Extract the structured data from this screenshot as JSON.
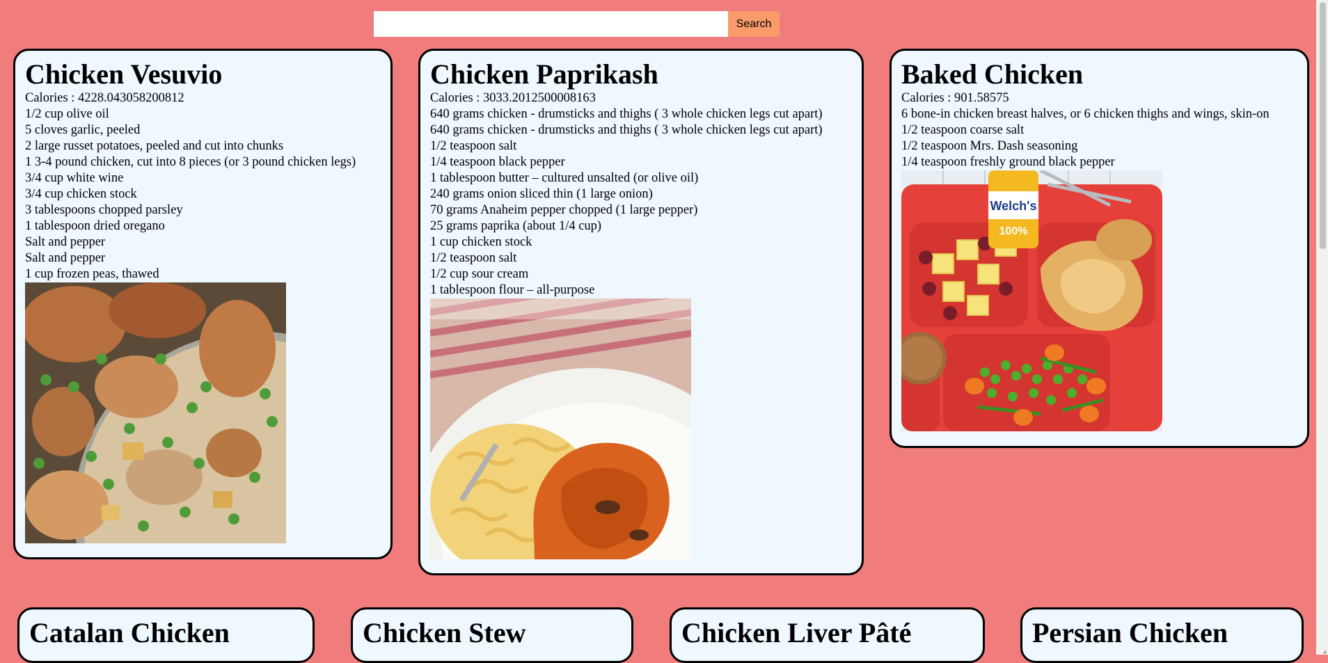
{
  "search": {
    "placeholder": "",
    "value": "",
    "button_label": "Search"
  },
  "recipes": [
    {
      "title": "Chicken Vesuvio",
      "calories": "Calories : 4228.043058200812",
      "ingredients": [
        "1/2 cup olive oil",
        "5 cloves garlic, peeled",
        "2 large russet potatoes, peeled and cut into chunks",
        "1 3-4 pound chicken, cut into 8 pieces (or 3 pound chicken legs)",
        "3/4 cup white wine",
        "3/4 cup chicken stock",
        "3 tablespoons chopped parsley",
        "1 tablespoon dried oregano",
        "Salt and pepper",
        "Salt and pepper",
        "1 cup frozen peas, thawed"
      ]
    },
    {
      "title": "Chicken Paprikash",
      "calories": "Calories : 3033.2012500008163",
      "ingredients": [
        "640 grams chicken - drumsticks and thighs ( 3 whole chicken legs cut apart)",
        "640 grams chicken - drumsticks and thighs ( 3 whole chicken legs cut apart)",
        "1/2 teaspoon salt",
        "1/4 teaspoon black pepper",
        "1 tablespoon butter – cultured unsalted (or olive oil)",
        "240 grams onion sliced thin (1 large onion)",
        "70 grams Anaheim pepper chopped (1 large pepper)",
        "25 grams paprika (about 1/4 cup)",
        "1 cup chicken stock",
        "1/2 teaspoon salt",
        "1/2 cup sour cream",
        "1 tablespoon flour – all-purpose"
      ]
    },
    {
      "title": "Baked Chicken",
      "calories": "Calories : 901.58575",
      "ingredients": [
        "6 bone-in chicken breast halves, or 6 chicken thighs and wings, skin-on",
        "1/2 teaspoon coarse salt",
        "1/2 teaspoon Mrs. Dash seasoning",
        "1/4 teaspoon freshly ground black pepper"
      ]
    }
  ],
  "bottom_recipes": [
    {
      "title": "Catalan Chicken"
    },
    {
      "title": "Chicken Stew"
    },
    {
      "title": "Chicken Liver Pâté"
    },
    {
      "title": "Persian Chicken"
    }
  ],
  "photos": [
    {
      "icon": "chicken-vesuvio-photo"
    },
    {
      "icon": "chicken-paprikash-photo",
      "label_text": ""
    },
    {
      "icon": "baked-chicken-tray-photo",
      "can_label": "Welch's",
      "can_sub": "100%"
    }
  ]
}
